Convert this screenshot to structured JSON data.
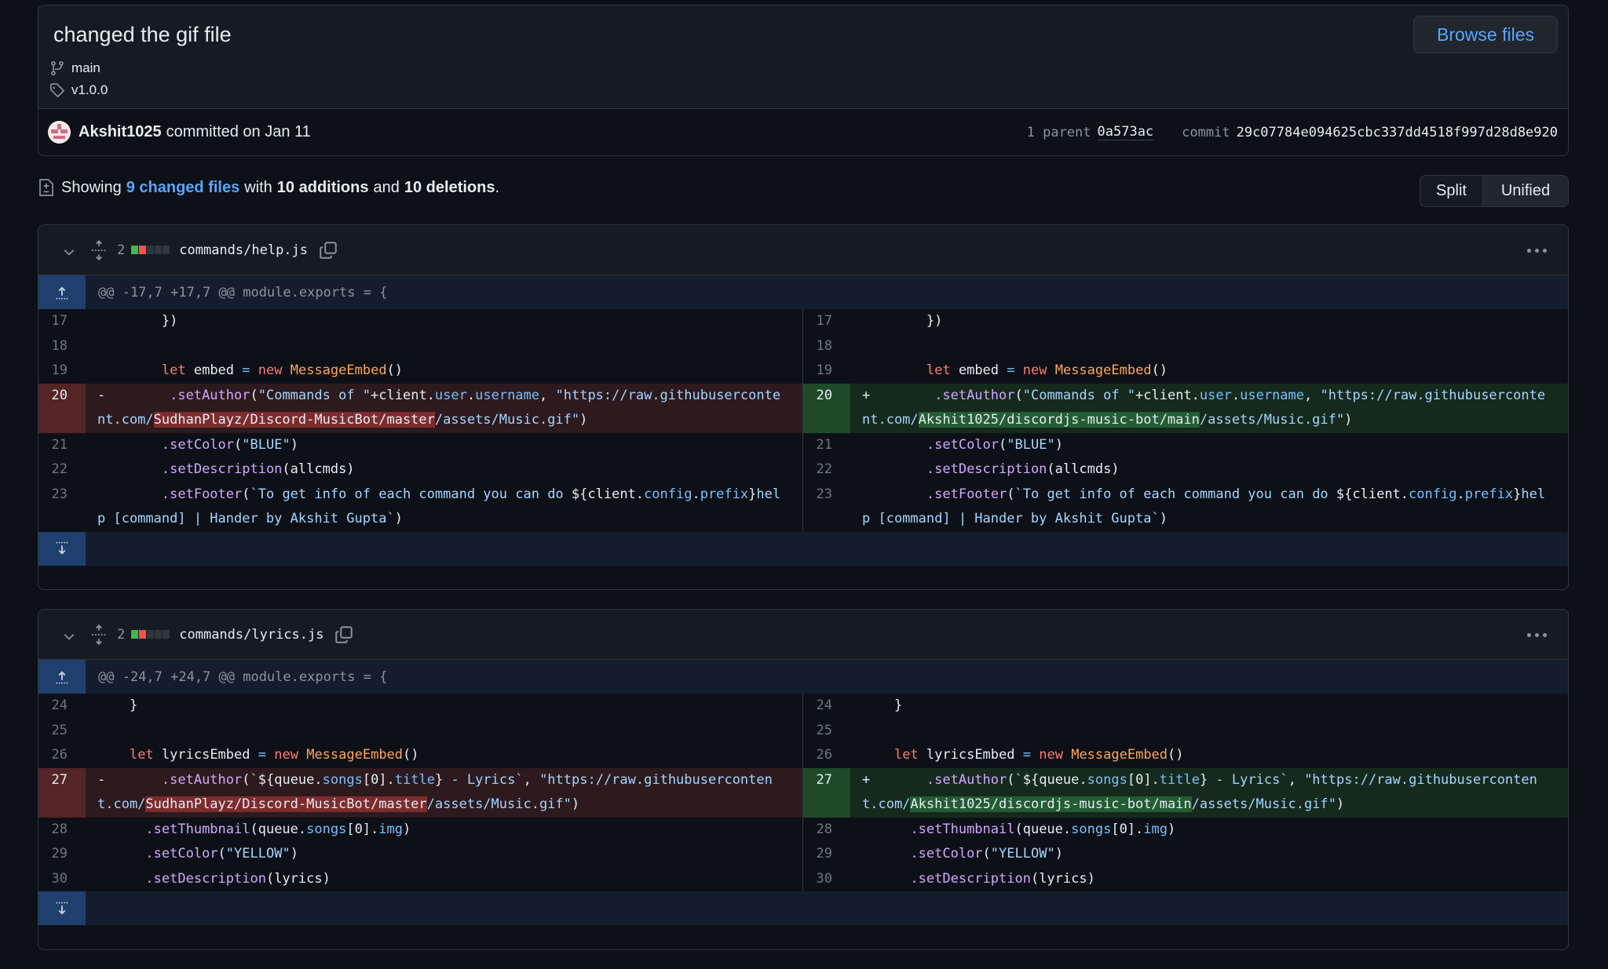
{
  "commit": {
    "title": "changed the gif file",
    "branch": "main",
    "tag": "v1.0.0",
    "browse_label": "Browse files",
    "author": "Akshit1025",
    "action": "committed on Jan 11",
    "parent_label": "1 parent",
    "parent_sha": "0a573ac",
    "commit_label": "commit",
    "commit_sha": "29c07784e094625cbc337dd4518f997d28d8e920"
  },
  "summary": {
    "prefix": "Showing",
    "changed_files": "9 changed files",
    "with": "with",
    "additions": "10 additions",
    "and": "and",
    "deletions": "10 deletions",
    "suffix": "."
  },
  "view_toggle": {
    "split": "Split",
    "unified": "Unified",
    "selected": "Unified"
  },
  "colors": {
    "accent": "#58a6ff",
    "addition": "#3fb950",
    "deletion": "#f85149",
    "neutral": "#30363d"
  },
  "files": [
    {
      "changes": "2",
      "diffstat": [
        "add",
        "del",
        "neutral",
        "neutral",
        "neutral"
      ],
      "name": "commands/help.js",
      "hunk": "@@ -17,7 +17,7 @@ module.exports = {",
      "lines": [
        {
          "type": "ctx",
          "left_num": "17",
          "right_num": "17",
          "tokens": [
            [
              "",
              "        })"
            ]
          ]
        },
        {
          "type": "ctx",
          "left_num": "18",
          "right_num": "18",
          "tokens": [
            [
              "",
              " "
            ]
          ]
        },
        {
          "type": "ctx",
          "left_num": "19",
          "right_num": "19",
          "tokens": [
            [
              "",
              "        "
            ],
            [
              "kw",
              "let"
            ],
            [
              "",
              " embed "
            ],
            [
              "op",
              "="
            ],
            [
              "",
              " "
            ],
            [
              "kw",
              "new"
            ],
            [
              "",
              " "
            ],
            [
              "cls",
              "MessageEmbed"
            ],
            [
              "",
              "()"
            ]
          ]
        },
        {
          "type": "change",
          "left_num": "20",
          "right_num": "20",
          "left_tokens": [
            [
              "",
              "-        "
            ],
            [
              "fn",
              ".setAuthor"
            ],
            [
              "",
              "("
            ],
            [
              "str",
              "\"Commands of \""
            ],
            [
              "",
              "+client."
            ],
            [
              "prop",
              "user"
            ],
            [
              "",
              "."
            ],
            [
              "prop",
              "username"
            ],
            [
              "",
              ", "
            ],
            [
              "str",
              "\"https://raw.githubusercontent.com/"
            ],
            [
              "hl-del",
              "SudhanPlayz/Discord-MusicBot/master"
            ],
            [
              "str",
              "/assets/Music.gif\""
            ],
            [
              "",
              ")"
            ]
          ],
          "right_tokens": [
            [
              "",
              "+        "
            ],
            [
              "fn",
              ".setAuthor"
            ],
            [
              "",
              "("
            ],
            [
              "str",
              "\"Commands of \""
            ],
            [
              "",
              "+client."
            ],
            [
              "prop",
              "user"
            ],
            [
              "",
              "."
            ],
            [
              "prop",
              "username"
            ],
            [
              "",
              ", "
            ],
            [
              "str",
              "\"https://raw.githubusercontent.com/"
            ],
            [
              "hl-add",
              "Akshit1025/discordjs-music-bot/main"
            ],
            [
              "str",
              "/assets/Music.gif\""
            ],
            [
              "",
              ")"
            ]
          ]
        },
        {
          "type": "ctx",
          "left_num": "21",
          "right_num": "21",
          "tokens": [
            [
              "",
              "        "
            ],
            [
              "fn",
              ".setColor"
            ],
            [
              "",
              "("
            ],
            [
              "str",
              "\"BLUE\""
            ],
            [
              "",
              ")"
            ]
          ]
        },
        {
          "type": "ctx",
          "left_num": "22",
          "right_num": "22",
          "tokens": [
            [
              "",
              "        "
            ],
            [
              "fn",
              ".setDescription"
            ],
            [
              "",
              "(allcmds)"
            ]
          ]
        },
        {
          "type": "ctx",
          "left_num": "23",
          "right_num": "23",
          "tokens": [
            [
              "",
              "        "
            ],
            [
              "fn",
              ".setFooter"
            ],
            [
              "",
              "("
            ],
            [
              "str",
              "`To get info of each command you can do "
            ],
            [
              "",
              "${client."
            ],
            [
              "prop",
              "config"
            ],
            [
              "",
              "."
            ],
            [
              "prop",
              "prefix"
            ],
            [
              "",
              "}"
            ],
            [
              "str",
              "help [command] | Hander by Akshit Gupta`"
            ],
            [
              "",
              ")"
            ]
          ]
        }
      ]
    },
    {
      "changes": "2",
      "diffstat": [
        "add",
        "del",
        "neutral",
        "neutral",
        "neutral"
      ],
      "name": "commands/lyrics.js",
      "hunk": "@@ -24,7 +24,7 @@ module.exports = {",
      "lines": [
        {
          "type": "ctx",
          "left_num": "24",
          "right_num": "24",
          "tokens": [
            [
              "",
              "    }"
            ]
          ]
        },
        {
          "type": "ctx",
          "left_num": "25",
          "right_num": "25",
          "tokens": [
            [
              "",
              " "
            ]
          ]
        },
        {
          "type": "ctx",
          "left_num": "26",
          "right_num": "26",
          "tokens": [
            [
              "",
              "    "
            ],
            [
              "kw",
              "let"
            ],
            [
              "",
              " lyricsEmbed "
            ],
            [
              "op",
              "="
            ],
            [
              "",
              " "
            ],
            [
              "kw",
              "new"
            ],
            [
              "",
              " "
            ],
            [
              "cls",
              "MessageEmbed"
            ],
            [
              "",
              "()"
            ]
          ]
        },
        {
          "type": "change",
          "left_num": "27",
          "right_num": "27",
          "left_tokens": [
            [
              "",
              "-       "
            ],
            [
              "fn",
              ".setAuthor"
            ],
            [
              "",
              "("
            ],
            [
              "str",
              "`"
            ],
            [
              "",
              "${queue."
            ],
            [
              "prop",
              "songs"
            ],
            [
              "",
              "[0]."
            ],
            [
              "prop",
              "title"
            ],
            [
              "",
              "}"
            ],
            [
              "str",
              " - Lyrics`"
            ],
            [
              "",
              ", "
            ],
            [
              "str",
              "\"https://raw.githubusercontent.com/"
            ],
            [
              "hl-del",
              "SudhanPlayz/Discord-MusicBot/master"
            ],
            [
              "str",
              "/assets/Music.gif\""
            ],
            [
              "",
              ")"
            ]
          ],
          "right_tokens": [
            [
              "",
              "+       "
            ],
            [
              "fn",
              ".setAuthor"
            ],
            [
              "",
              "("
            ],
            [
              "str",
              "`"
            ],
            [
              "",
              "${queue."
            ],
            [
              "prop",
              "songs"
            ],
            [
              "",
              "[0]."
            ],
            [
              "prop",
              "title"
            ],
            [
              "",
              "}"
            ],
            [
              "str",
              " - Lyrics`"
            ],
            [
              "",
              ", "
            ],
            [
              "str",
              "\"https://raw.githubusercontent.com/"
            ],
            [
              "hl-add",
              "Akshit1025/discordjs-music-bot/main"
            ],
            [
              "str",
              "/assets/Music.gif\""
            ],
            [
              "",
              ")"
            ]
          ]
        },
        {
          "type": "ctx",
          "left_num": "28",
          "right_num": "28",
          "tokens": [
            [
              "",
              "      "
            ],
            [
              "fn",
              ".setThumbnail"
            ],
            [
              "",
              "(queue."
            ],
            [
              "prop",
              "songs"
            ],
            [
              "",
              "[0]."
            ],
            [
              "prop",
              "img"
            ],
            [
              "",
              ")"
            ]
          ]
        },
        {
          "type": "ctx",
          "left_num": "29",
          "right_num": "29",
          "tokens": [
            [
              "",
              "      "
            ],
            [
              "fn",
              ".setColor"
            ],
            [
              "",
              "("
            ],
            [
              "str",
              "\"YELLOW\""
            ],
            [
              "",
              ")"
            ]
          ]
        },
        {
          "type": "ctx",
          "left_num": "30",
          "right_num": "30",
          "tokens": [
            [
              "",
              "      "
            ],
            [
              "fn",
              ".setDescription"
            ],
            [
              "",
              "(lyrics)"
            ]
          ]
        }
      ]
    }
  ]
}
